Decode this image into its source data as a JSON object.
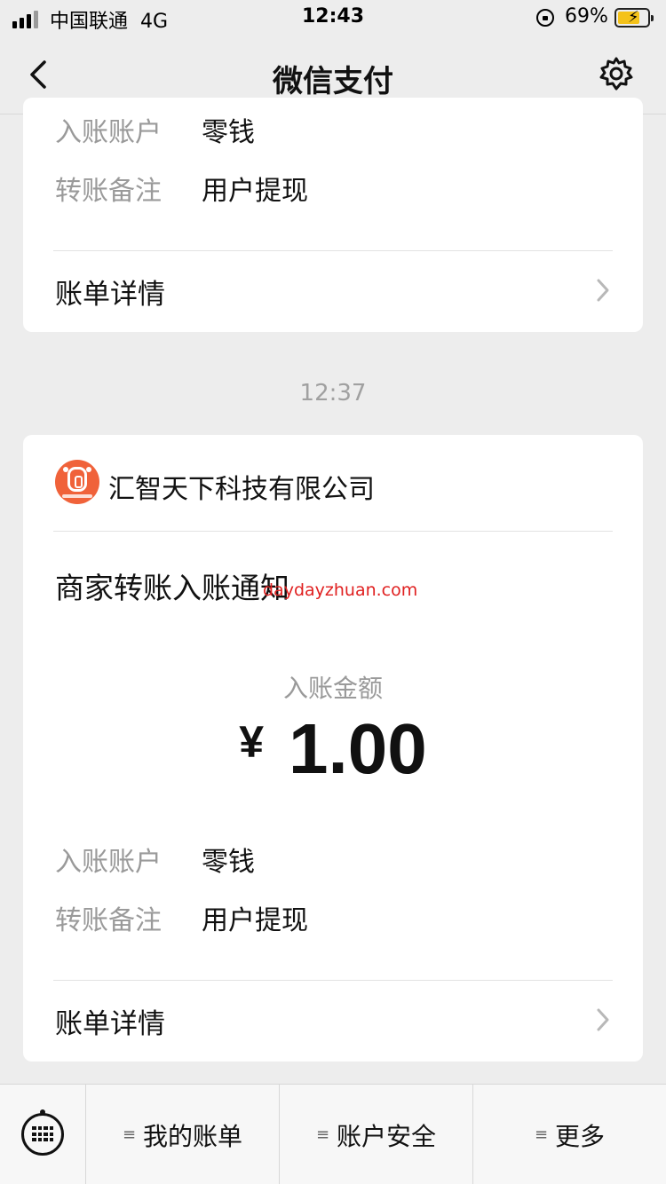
{
  "status_bar": {
    "carrier": "中国联通",
    "network": "4G",
    "time": "12:43",
    "battery_percent": "69%",
    "icons": [
      "signal-icon",
      "orientation-lock-icon",
      "battery-charging-icon"
    ]
  },
  "nav": {
    "title": "微信支付",
    "icons": [
      "back-icon",
      "settings-gear-icon"
    ]
  },
  "previous_card": {
    "rows": [
      {
        "label": "入账账户",
        "value": "零钱"
      },
      {
        "label": "转账备注",
        "value": "用户提现"
      }
    ],
    "detail_link": "账单详情"
  },
  "timestamp": "12:37",
  "notification_card": {
    "merchant_name": "汇智天下科技有限公司",
    "notice_title": "商家转账入账通知",
    "watermark": "daydayzhuan.com",
    "amount_label": "入账金额",
    "currency": "¥",
    "amount": "1.00",
    "rows": [
      {
        "label": "入账账户",
        "value": "零钱"
      },
      {
        "label": "转账备注",
        "value": "用户提现"
      }
    ],
    "detail_link": "账单详情"
  },
  "bottom_menu": {
    "items": [
      {
        "label": "我的账单"
      },
      {
        "label": "账户安全"
      },
      {
        "label": "更多"
      }
    ]
  },
  "colors": {
    "background": "#ededed",
    "card": "#ffffff",
    "label_gray": "#9a9a9a",
    "merchant_logo": "#f0623a",
    "battery_fill": "#f4c21a",
    "watermark": "#e02020"
  }
}
